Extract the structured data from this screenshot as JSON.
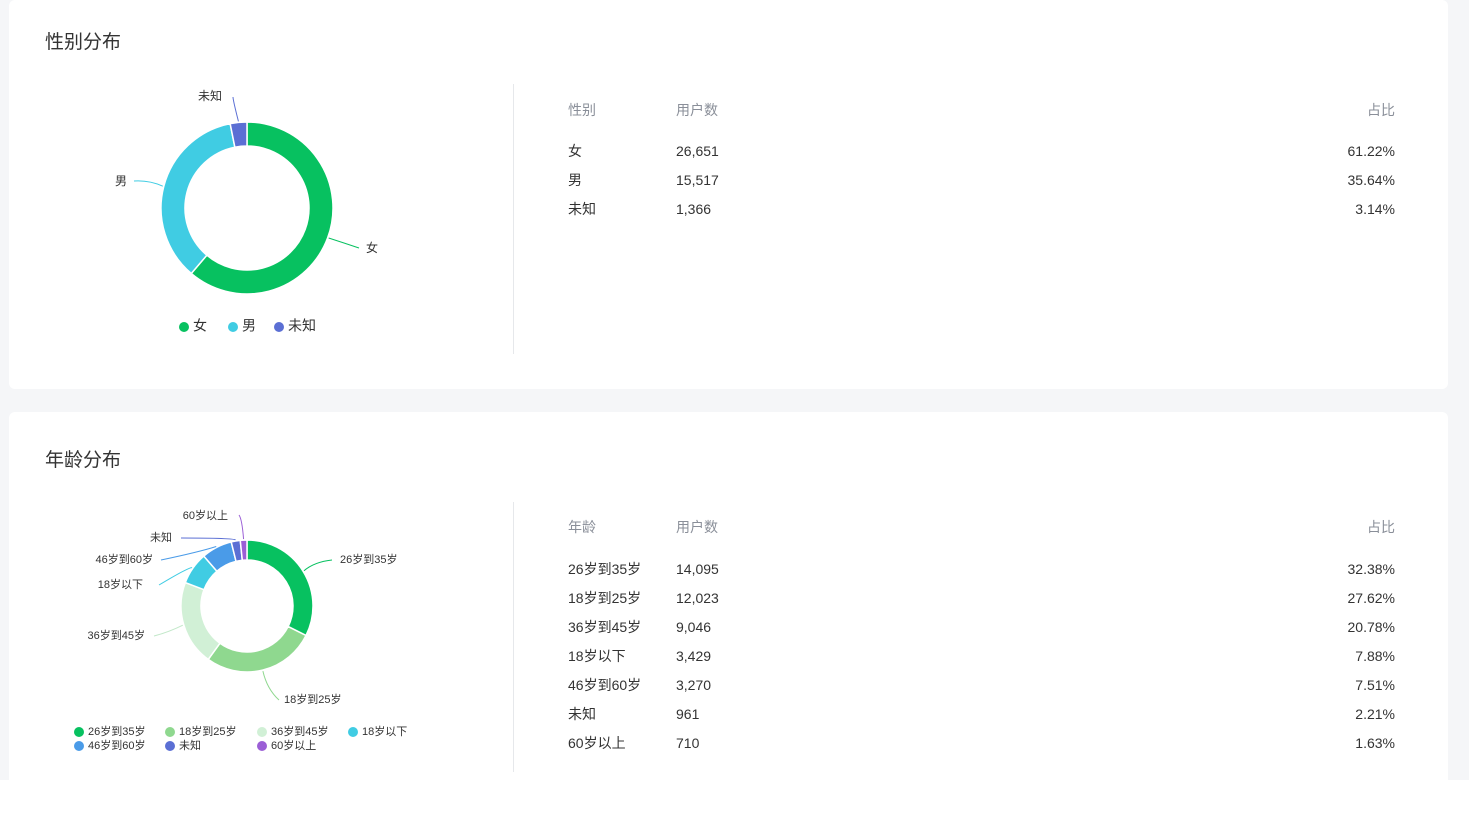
{
  "chart_data": [
    {
      "type": "pie",
      "title": "性别分布",
      "categories": [
        "女",
        "男",
        "未知"
      ],
      "values": [
        26651,
        15517,
        1366
      ],
      "percents": [
        "61.22%",
        "35.64%",
        "3.14%"
      ],
      "colors": [
        "#07c160",
        "#40cce3",
        "#5b6fd4"
      ],
      "legend": [
        "女",
        "男",
        "未知"
      ],
      "legend_position": "bottom",
      "donut": true
    },
    {
      "type": "pie",
      "title": "年龄分布",
      "categories": [
        "26岁到35岁",
        "18岁到25岁",
        "36岁到45岁",
        "18岁以下",
        "46岁到60岁",
        "未知",
        "60岁以上"
      ],
      "values": [
        14095,
        12023,
        9046,
        3429,
        3270,
        961,
        710
      ],
      "percents": [
        "32.38%",
        "27.62%",
        "20.78%",
        "7.88%",
        "7.51%",
        "2.21%",
        "1.63%"
      ],
      "colors": [
        "#07c160",
        "#8fd88f",
        "#d1f0d6",
        "#40cce3",
        "#4a9be8",
        "#5b6fd4",
        "#9b5fd6"
      ],
      "legend": [
        "26岁到35岁",
        "18岁到25岁",
        "36岁到45岁",
        "18岁以下",
        "46岁到60岁",
        "未知",
        "60岁以上"
      ],
      "legend_position": "bottom",
      "donut": true
    }
  ],
  "gender": {
    "title": "性别分布",
    "headers": [
      "性别",
      "用户数",
      "占比"
    ],
    "rows": [
      [
        "女",
        "26,651",
        "61.22%"
      ],
      [
        "男",
        "15,517",
        "35.64%"
      ],
      [
        "未知",
        "1,366",
        "3.14%"
      ]
    ]
  },
  "age": {
    "title": "年龄分布",
    "headers": [
      "年龄",
      "用户数",
      "占比"
    ],
    "rows": [
      [
        "26岁到35岁",
        "14,095",
        "32.38%"
      ],
      [
        "18岁到25岁",
        "12,023",
        "27.62%"
      ],
      [
        "36岁到45岁",
        "9,046",
        "20.78%"
      ],
      [
        "18岁以下",
        "3,429",
        "7.88%"
      ],
      [
        "46岁到60岁",
        "3,270",
        "7.51%"
      ],
      [
        "未知",
        "961",
        "2.21%"
      ],
      [
        "60岁以上",
        "710",
        "1.63%"
      ]
    ]
  }
}
